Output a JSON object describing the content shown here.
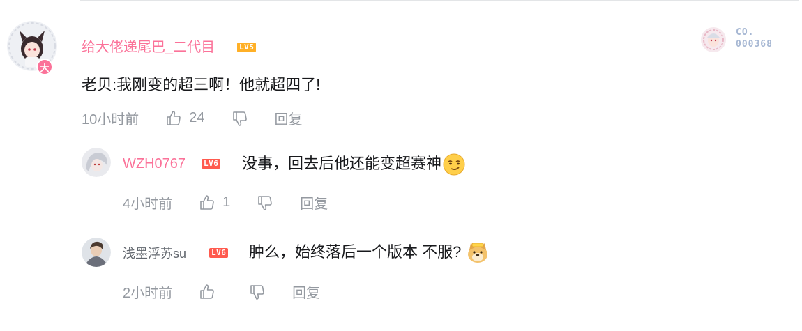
{
  "main_comment": {
    "username": "给大佬递尾巴_二代目",
    "level": "LV5",
    "vip_badge": "大",
    "content": "老贝:我刚变的超三啊！他就超四了!",
    "time": "10小时前",
    "likes": "24",
    "reply_label": "回复",
    "decoration": {
      "line1": "CO.",
      "line2": "000368"
    }
  },
  "replies": [
    {
      "username": "WZH0767",
      "level": "LV6",
      "content": "没事，回去后他还能变超赛神",
      "emoji": "smirk-emoji",
      "time": "4小时前",
      "likes": "1",
      "reply_label": "回复"
    },
    {
      "username": "浅墨浮苏su",
      "level": "LV6",
      "content": "肿么，始终落后一个版本 不服?",
      "emoji": "doge-emoji",
      "time": "2小时前",
      "likes": "",
      "reply_label": "回复"
    }
  ],
  "colors": {
    "username_pink": "#fb7299",
    "lv5": "#ffb027",
    "lv6": "#ff5a4e",
    "meta_gray": "#9499a0"
  }
}
